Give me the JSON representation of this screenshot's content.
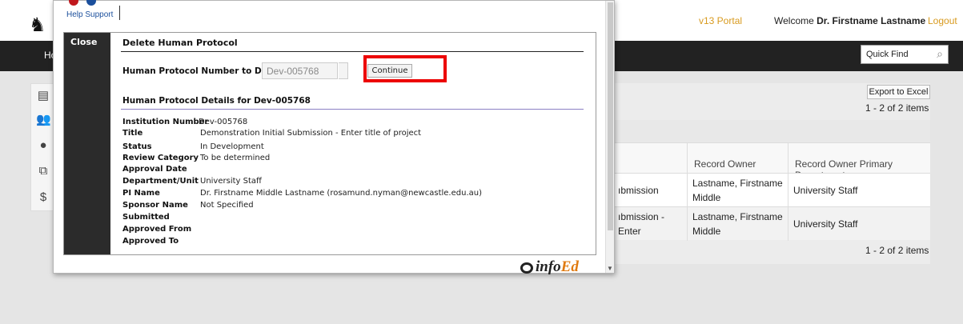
{
  "header": {
    "portal_link": "v13 Portal",
    "welcome_prefix": "Welcome ",
    "user_name": "Dr. Firstname Lastname",
    "logout": "Logout"
  },
  "nav": {
    "home_partial": "Ho",
    "quick_find_placeholder": "Quick Find"
  },
  "sidebar": {
    "icons": [
      "document-icon",
      "users-icon",
      "globe-icon",
      "copy-icon",
      "money-icon"
    ]
  },
  "grid": {
    "export_button": "Export to Excel",
    "items_count_top": "1 - 2 of 2 items",
    "items_count_bottom": "1 - 2 of 2 items",
    "columns": [
      "Record Owner",
      "Record Owner Primary Department"
    ],
    "rows": [
      {
        "title_partial": "ıbmission",
        "owner": "Lastname, Firstname Middle",
        "department": "University Staff"
      },
      {
        "title_partial": "ıbmission - Enter",
        "owner": "Lastname, Firstname Middle",
        "department": "University Staff"
      }
    ]
  },
  "modal": {
    "help": "Help",
    "support": "Support",
    "close": "Close",
    "title": "Delete Human Protocol",
    "delete_label": "Human Protocol Number to Delete:",
    "delete_input_value": "Dev-005768",
    "continue_button": "Continue",
    "details_heading": "Human Protocol Details for Dev-005768",
    "details": [
      {
        "key": "Institution Number",
        "value": "Dev-005768"
      },
      {
        "key": "Title",
        "value": "Demonstration Initial Submission - Enter title of project"
      },
      {
        "key": "Status",
        "value": "In Development"
      },
      {
        "key": "Review Category",
        "value": "To be determined"
      },
      {
        "key": "Approval Date",
        "value": ""
      },
      {
        "key": "Department/Unit",
        "value": "University Staff"
      },
      {
        "key": "PI Name",
        "value": "Dr. Firstname Middle Lastname (rosamund.nyman@newcastle.edu.au)"
      },
      {
        "key": "Sponsor Name",
        "value": "Not Specified"
      },
      {
        "key": "Submitted",
        "value": ""
      },
      {
        "key": "Approved From",
        "value": ""
      },
      {
        "key": "Approved To",
        "value": ""
      }
    ],
    "brand_prefix": "info",
    "brand_suffix": "Ed"
  },
  "colors": {
    "accent_link": "#d89a1e",
    "highlight": "#ec0000",
    "navbar": "#222222"
  }
}
